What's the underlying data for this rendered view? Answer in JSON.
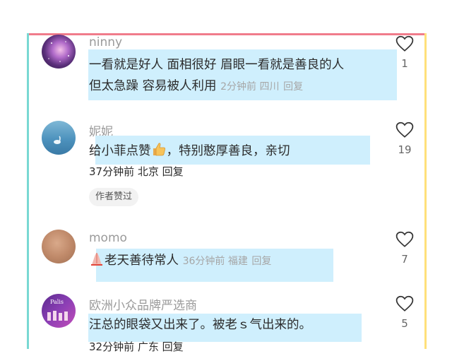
{
  "comments": [
    {
      "username": "ninny",
      "text_line1": "一看就是好人 面相很好 眉眼一看就是善良的人",
      "text_line2": "但太急躁 容易被人利用",
      "meta": "2分钟前 四川",
      "reply": "回复",
      "likes": "1"
    },
    {
      "username": "妮妮",
      "text_part1": "给小菲点赞",
      "text_part2": "，特别憨厚善良，亲切",
      "meta": "37分钟前 北京",
      "reply": "回复",
      "badge": "作者赞过",
      "likes": "19"
    },
    {
      "username": "momo",
      "text": "老天善待常人",
      "meta": "36分钟前 福建",
      "reply": "回复",
      "likes": "7"
    },
    {
      "username": "欧洲小众品牌严选商",
      "text": "汪总的眼袋又出来了。被老ｓ气出来的。",
      "meta": "32分钟前 广东",
      "reply": "回复",
      "likes": "5",
      "avatar_text": "Palis"
    }
  ],
  "colors": {
    "highlight": "#cfeffd",
    "frame_top": "#f07c8b",
    "frame_left": "#79d8d3",
    "frame_right": "#ffe07a"
  },
  "icons": {
    "like": "heart-outline-icon",
    "thumbs_up": "thumbs-up-emoji",
    "prayer": "pray-emoji"
  }
}
